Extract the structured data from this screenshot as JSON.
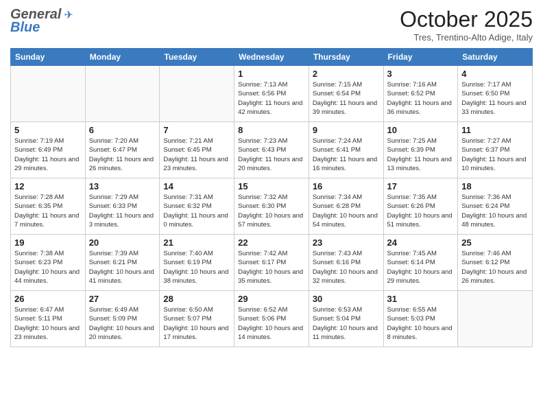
{
  "header": {
    "logo_general": "General",
    "logo_blue": "Blue",
    "month_title": "October 2025",
    "location": "Tres, Trentino-Alto Adige, Italy"
  },
  "days_of_week": [
    "Sunday",
    "Monday",
    "Tuesday",
    "Wednesday",
    "Thursday",
    "Friday",
    "Saturday"
  ],
  "weeks": [
    [
      {
        "day": "",
        "info": ""
      },
      {
        "day": "",
        "info": ""
      },
      {
        "day": "",
        "info": ""
      },
      {
        "day": "1",
        "info": "Sunrise: 7:13 AM\nSunset: 6:56 PM\nDaylight: 11 hours and 42 minutes."
      },
      {
        "day": "2",
        "info": "Sunrise: 7:15 AM\nSunset: 6:54 PM\nDaylight: 11 hours and 39 minutes."
      },
      {
        "day": "3",
        "info": "Sunrise: 7:16 AM\nSunset: 6:52 PM\nDaylight: 11 hours and 36 minutes."
      },
      {
        "day": "4",
        "info": "Sunrise: 7:17 AM\nSunset: 6:50 PM\nDaylight: 11 hours and 33 minutes."
      }
    ],
    [
      {
        "day": "5",
        "info": "Sunrise: 7:19 AM\nSunset: 6:49 PM\nDaylight: 11 hours and 29 minutes."
      },
      {
        "day": "6",
        "info": "Sunrise: 7:20 AM\nSunset: 6:47 PM\nDaylight: 11 hours and 26 minutes."
      },
      {
        "day": "7",
        "info": "Sunrise: 7:21 AM\nSunset: 6:45 PM\nDaylight: 11 hours and 23 minutes."
      },
      {
        "day": "8",
        "info": "Sunrise: 7:23 AM\nSunset: 6:43 PM\nDaylight: 11 hours and 20 minutes."
      },
      {
        "day": "9",
        "info": "Sunrise: 7:24 AM\nSunset: 6:41 PM\nDaylight: 11 hours and 16 minutes."
      },
      {
        "day": "10",
        "info": "Sunrise: 7:25 AM\nSunset: 6:39 PM\nDaylight: 11 hours and 13 minutes."
      },
      {
        "day": "11",
        "info": "Sunrise: 7:27 AM\nSunset: 6:37 PM\nDaylight: 11 hours and 10 minutes."
      }
    ],
    [
      {
        "day": "12",
        "info": "Sunrise: 7:28 AM\nSunset: 6:35 PM\nDaylight: 11 hours and 7 minutes."
      },
      {
        "day": "13",
        "info": "Sunrise: 7:29 AM\nSunset: 6:33 PM\nDaylight: 11 hours and 3 minutes."
      },
      {
        "day": "14",
        "info": "Sunrise: 7:31 AM\nSunset: 6:32 PM\nDaylight: 11 hours and 0 minutes."
      },
      {
        "day": "15",
        "info": "Sunrise: 7:32 AM\nSunset: 6:30 PM\nDaylight: 10 hours and 57 minutes."
      },
      {
        "day": "16",
        "info": "Sunrise: 7:34 AM\nSunset: 6:28 PM\nDaylight: 10 hours and 54 minutes."
      },
      {
        "day": "17",
        "info": "Sunrise: 7:35 AM\nSunset: 6:26 PM\nDaylight: 10 hours and 51 minutes."
      },
      {
        "day": "18",
        "info": "Sunrise: 7:36 AM\nSunset: 6:24 PM\nDaylight: 10 hours and 48 minutes."
      }
    ],
    [
      {
        "day": "19",
        "info": "Sunrise: 7:38 AM\nSunset: 6:23 PM\nDaylight: 10 hours and 44 minutes."
      },
      {
        "day": "20",
        "info": "Sunrise: 7:39 AM\nSunset: 6:21 PM\nDaylight: 10 hours and 41 minutes."
      },
      {
        "day": "21",
        "info": "Sunrise: 7:40 AM\nSunset: 6:19 PM\nDaylight: 10 hours and 38 minutes."
      },
      {
        "day": "22",
        "info": "Sunrise: 7:42 AM\nSunset: 6:17 PM\nDaylight: 10 hours and 35 minutes."
      },
      {
        "day": "23",
        "info": "Sunrise: 7:43 AM\nSunset: 6:16 PM\nDaylight: 10 hours and 32 minutes."
      },
      {
        "day": "24",
        "info": "Sunrise: 7:45 AM\nSunset: 6:14 PM\nDaylight: 10 hours and 29 minutes."
      },
      {
        "day": "25",
        "info": "Sunrise: 7:46 AM\nSunset: 6:12 PM\nDaylight: 10 hours and 26 minutes."
      }
    ],
    [
      {
        "day": "26",
        "info": "Sunrise: 6:47 AM\nSunset: 5:11 PM\nDaylight: 10 hours and 23 minutes."
      },
      {
        "day": "27",
        "info": "Sunrise: 6:49 AM\nSunset: 5:09 PM\nDaylight: 10 hours and 20 minutes."
      },
      {
        "day": "28",
        "info": "Sunrise: 6:50 AM\nSunset: 5:07 PM\nDaylight: 10 hours and 17 minutes."
      },
      {
        "day": "29",
        "info": "Sunrise: 6:52 AM\nSunset: 5:06 PM\nDaylight: 10 hours and 14 minutes."
      },
      {
        "day": "30",
        "info": "Sunrise: 6:53 AM\nSunset: 5:04 PM\nDaylight: 10 hours and 11 minutes."
      },
      {
        "day": "31",
        "info": "Sunrise: 6:55 AM\nSunset: 5:03 PM\nDaylight: 10 hours and 8 minutes."
      },
      {
        "day": "",
        "info": ""
      }
    ]
  ]
}
